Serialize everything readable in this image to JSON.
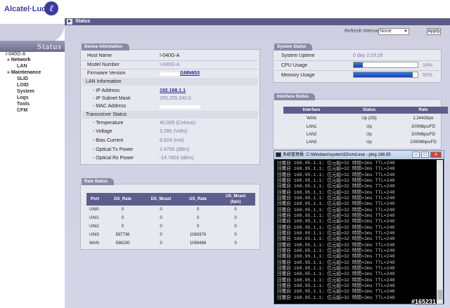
{
  "brand": {
    "name": "Alcatel·Lucent",
    "logo_glyph": "ℓ"
  },
  "sidebar": {
    "title": "Status",
    "device": "I-040G-A",
    "items": [
      {
        "label": "» Network",
        "level": "main"
      },
      {
        "label": "LAN",
        "level": "sub"
      },
      {
        "label": "» Maintenance",
        "level": "main"
      },
      {
        "label": "SLID",
        "level": "sub"
      },
      {
        "label": "LOID",
        "level": "sub"
      },
      {
        "label": "System",
        "level": "sub"
      },
      {
        "label": "Logs",
        "level": "sub"
      },
      {
        "label": "Tools",
        "level": "sub"
      },
      {
        "label": "CFM",
        "level": "sub"
      }
    ]
  },
  "breadcrumb": {
    "arrow": "►",
    "label": "Status"
  },
  "refresh": {
    "label": "Refresh Interval:",
    "value": "None",
    "apply": "Apply"
  },
  "device_info": {
    "tab": "Device Information",
    "host_name_label": "Host Name",
    "host_name": "I-040G-A",
    "model_label": "Model Number",
    "model": "I-040G-A",
    "firmware_label": "Firmware Version",
    "firmware": "GMN653",
    "lan_section": "LAN Information",
    "ip_label": "- IP Address",
    "ip": "192.168.1.1",
    "mask_label": "- IP Subnet Mask",
    "mask": "255.255.240.0",
    "mac_label": "- MAC Address",
    "transceiver_section": "Transceiver Status",
    "temp_label": "- Temperature",
    "temp": "40.000 (Celsius)",
    "voltage_label": "- Voltage",
    "voltage": "3.286 (Volts)",
    "bias_label": "- Bias Current",
    "bias": "8.624 (mA)",
    "tx_label": "- Optical Tx Power",
    "tx": "2.4700 (dBm)",
    "rx_label": "- Optical Rx Power",
    "rx": "-14.7603 (dBm)"
  },
  "system_status": {
    "tab": "System Status",
    "uptime_label": "System Uptime",
    "uptime": "0 day 2:19:29",
    "cpu_label": "CPU Usage",
    "cpu": "14%",
    "cpu_fraction": 0.14,
    "mem_label": "Memory Usage",
    "mem": "92%",
    "mem_fraction": 0.92
  },
  "interface_status": {
    "tab": "Interface Status",
    "headers": [
      "Interface",
      "Status",
      "Rate"
    ],
    "rows": [
      [
        "WAN",
        "Up (O5)",
        "1.244Gbps"
      ],
      [
        "LAN1",
        "Up",
        "100Mbps/FD"
      ],
      [
        "LAN2",
        "Up",
        "100Mbps/FD"
      ],
      [
        "LAN3",
        "Up",
        "1000Mbps/FD"
      ]
    ]
  },
  "rate_status": {
    "tab": "Rate Status",
    "headers": [
      "Port",
      "DS_Rate",
      "DS_Mcast",
      "US_Rate",
      "US_Mcast\n(bps)"
    ],
    "rows": [
      [
        "UNI0",
        "0",
        "0",
        "0",
        "0"
      ],
      [
        "UNI1",
        "0",
        "0",
        "0",
        "0"
      ],
      [
        "UNI2",
        "0",
        "0",
        "0",
        "0"
      ],
      [
        "UNI3",
        "587736",
        "0",
        "1069376",
        "0"
      ],
      [
        "WAN",
        "586200",
        "0",
        "1069488",
        "0"
      ]
    ]
  },
  "cmd": {
    "title": "系統管理員: C:\\Windows\\system32\\cmd.exe - ping  168.95",
    "min": "–",
    "max": "□",
    "close": "X",
    "lines": [
      "回覆自 168.95.1.1: 位元組=32 時間=2ms TTL=248",
      "回覆自 168.95.1.1: 位元組=32 時間=2ms TTL=248",
      "回覆自 168.95.1.1: 位元組=32 時間=3ms TTL=248",
      "回覆自 168.95.1.1: 位元組=32 時間=2ms TTL=248",
      "回覆自 168.95.1.1: 位元組=32 時間=2ms TTL=248",
      "回覆自 168.95.1.1: 位元組=32 時間=2ms TTL=248",
      "回覆自 168.95.1.1: 位元組=32 時間=1ms TTL=248",
      "回覆自 168.95.1.1: 位元組=32 時間=2ms TTL=248",
      "回覆自 168.95.1.1: 位元組=32 時間=2ms TTL=248",
      "回覆自 168.95.1.1: 位元組=32 時間=2ms TTL=248",
      "回覆自 168.95.1.1: 位元組=32 時間=2ms TTL=248",
      "回覆自 168.95.1.1: 位元組=32 時間=2ms TTL=248",
      "回覆自 168.95.1.1: 位元組=32 時間=3ms TTL=248",
      "回覆自 168.95.1.1: 位元組=32 時間=2ms TTL=248",
      "回覆自 168.95.1.1: 位元組=32 時間=2ms TTL=248",
      "回覆自 168.95.1.1: 位元組=32 時間=2ms TTL=248",
      "回覆自 168.95.1.1: 位元組=32 時間=2ms TTL=248",
      "回覆自 168.95.1.1: 位元組=32 時間=2ms TTL=248",
      "回覆自 168.95.1.1: 位元組=32 時間=2ms TTL=248",
      "回覆自 168.95.1.1: 位元組=32 時間=1ms TTL=248",
      "回覆自 168.95.1.1: 位元組=32 時間=2ms TTL=248",
      "回覆自 168.95.1.1: 位元組=32 時間=2ms TTL=248",
      "回覆自 168.95.1.1: 位元組=32 時間=1ms TTL=248",
      "回覆自 168.95.1.1: 位元組=32 時間=2ms TTL=248"
    ]
  },
  "watermark": "#165231"
}
